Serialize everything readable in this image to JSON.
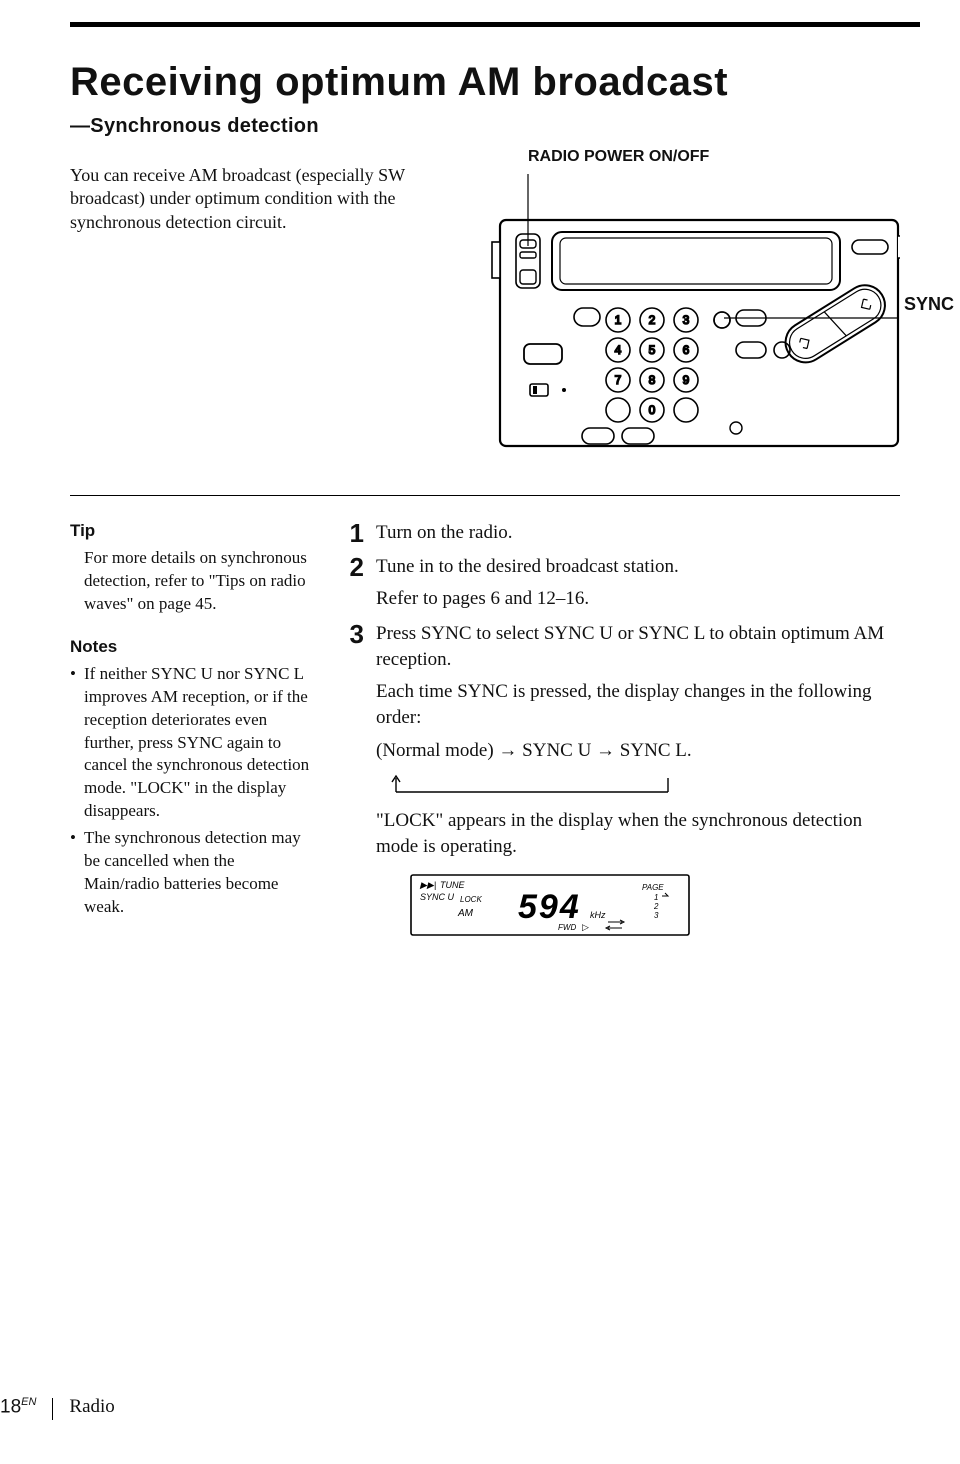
{
  "title": "Receiving optimum AM broadcast",
  "subtitle": "—Synchronous detection",
  "intro": "You can receive AM broadcast (especially SW broadcast) under optimum condition with the synchronous detection circuit.",
  "labels": {
    "power": "RADIO POWER ON/OFF",
    "sync": "SYNC"
  },
  "keypad": [
    "1",
    "2",
    "3",
    "4",
    "5",
    "6",
    "7",
    "8",
    "9",
    "0"
  ],
  "tip": {
    "heading": "Tip",
    "body": "For more details on synchronous detection, refer to \"Tips on radio waves\" on page 45."
  },
  "notes": {
    "heading": "Notes",
    "items": [
      "If neither SYNC U nor SYNC L improves AM reception, or if the reception deteriorates even further, press SYNC again to cancel the synchronous detection mode. \"LOCK\" in the display disappears.",
      "The synchronous detection may be cancelled when the Main/radio batteries become weak."
    ]
  },
  "steps": [
    {
      "body": "Turn on the radio."
    },
    {
      "body": "Tune in to the desired broadcast station.",
      "extra": "Refer to pages 6 and 12–16."
    },
    {
      "body": "Press SYNC to select SYNC U or SYNC L to obtain optimum AM reception.",
      "extra1": "Each time SYNC is pressed, the display changes in the following order:",
      "modes": "(Normal mode) → SYNC U → SYNC L.",
      "extra2": "\"LOCK\" appears in the display when the synchronous detection mode is operating."
    }
  ],
  "lcd": {
    "tune": "TUNE",
    "syncu": "SYNC U",
    "lock": "LOCK",
    "am": "AM",
    "freq": "594",
    "unit": "kHz",
    "page": "PAGE",
    "p1": "1",
    "p2": "2",
    "p3": "3",
    "fwd": "FWD"
  },
  "footer": {
    "page": "18",
    "lang": "EN",
    "section": "Radio"
  }
}
